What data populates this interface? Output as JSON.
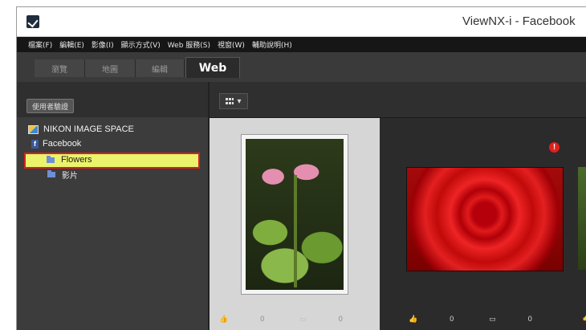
{
  "window": {
    "title": "ViewNX-i - Facebook"
  },
  "menu": [
    "檔案(F)",
    "編輯(E)",
    "影像(I)",
    "顯示方式(V)",
    "Web 服務(S)",
    "視窗(W)",
    "輔助說明(H)"
  ],
  "tabs": [
    "瀏覽",
    "地圖",
    "編輯",
    "Web"
  ],
  "active_tab": "Web",
  "left_panel": {
    "auth_button": "使用者驗證",
    "tree": {
      "service": "NIKON IMAGE SPACE",
      "facebook": "Facebook",
      "selected_album": "Flowers",
      "album_2": "影片"
    }
  },
  "toolbar": {
    "view_icon": "grid-view-icon",
    "dropdown": "▾"
  },
  "photos": [
    {
      "name": "lotus",
      "likes": "0",
      "comments": "0",
      "selected": true
    },
    {
      "name": "rose",
      "likes": "0",
      "comments": "0",
      "selected": false,
      "alert": "!"
    }
  ],
  "colors": {
    "selection_highlight": "#eaf36b",
    "selection_border": "#d6201e",
    "alert": "#e0201c"
  }
}
